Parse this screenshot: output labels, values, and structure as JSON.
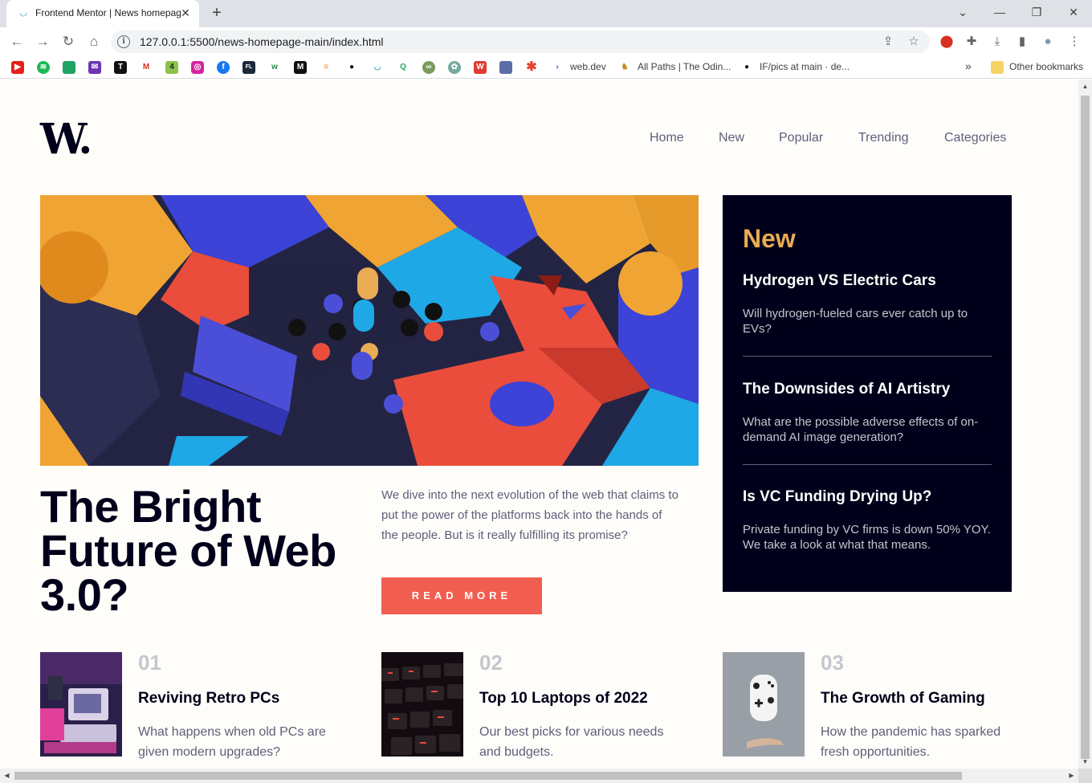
{
  "browser": {
    "tab_title": "Frontend Mentor | News homepage",
    "url": "127.0.0.1:5500/news-homepage-main/index.html",
    "bookmarks": [
      {
        "label": "web.dev"
      },
      {
        "label": "All Paths | The Odin..."
      },
      {
        "label": "IF/pics at main · de..."
      },
      {
        "label": "Other bookmarks"
      }
    ],
    "overflow_label": "»"
  },
  "site": {
    "logo": "W.",
    "nav": [
      "Home",
      "New",
      "Popular",
      "Trending",
      "Categories"
    ]
  },
  "hero": {
    "title": "The Bright Future of Web 3.0?",
    "description": "We dive into the next evolution of the web that claims to put the power of the platforms back into the hands of the people. But is it really fulfilling its promise?",
    "button_label": "READ MORE"
  },
  "new_section": {
    "heading": "New",
    "items": [
      {
        "title": "Hydrogen VS Electric Cars",
        "text": "Will hydrogen-fueled cars ever catch up to EVs?"
      },
      {
        "title": "The Downsides of AI Artistry",
        "text": "What are the possible adverse effects of on-demand AI image generation?"
      },
      {
        "title": "Is VC Funding Drying Up?",
        "text": "Private funding by VC firms is down 50% YOY. We take a look at what that means."
      }
    ]
  },
  "cards": [
    {
      "number": "01",
      "title": "Reviving Retro PCs",
      "text": "What happens when old PCs are given modern upgrades?"
    },
    {
      "number": "02",
      "title": "Top 10 Laptops of 2022",
      "text": "Our best picks for various needs and budgets."
    },
    {
      "number": "03",
      "title": "The Growth of Gaming",
      "text": "How the pandemic has sparked fresh opportunities."
    }
  ],
  "colors": {
    "accent_red": "#f15e50",
    "accent_orange": "#e9ab53",
    "dark_navy": "#00001a",
    "grayish_blue": "#5d5f79",
    "grayish_light": "#c5c6ce"
  }
}
